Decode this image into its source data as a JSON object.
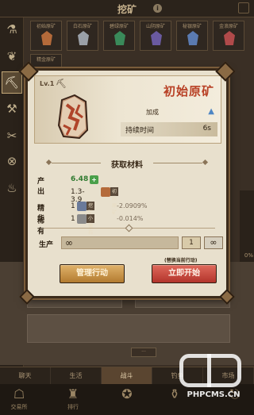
{
  "topbar": {
    "title": "挖矿"
  },
  "ore_slots": [
    {
      "label": "初始原矿",
      "color": "#b46a3a"
    },
    {
      "label": "白石原矿",
      "color": "#9aa0a8"
    },
    {
      "label": "碧绿原矿",
      "color": "#3a8a5a"
    },
    {
      "label": "山阴原矿",
      "color": "#6a5aa0"
    },
    {
      "label": "秘银原矿",
      "color": "#5a7ab0"
    },
    {
      "label": "金浪原矿",
      "color": "#b04a4a"
    }
  ],
  "ore_slot_extra": {
    "label": "精金原矿"
  },
  "modal": {
    "level": "Lv.1",
    "ore_name": "初始原矿",
    "bonus_label": "加成",
    "duration_label": "持续时间",
    "duration_value": "6s",
    "section_title": "获取材料",
    "output_label": "产出",
    "output_value": "6.48",
    "output_range": "1.3-3.9",
    "output_item": "初始原矿",
    "essence_label": "精华",
    "essence_count": "1",
    "essence_item": "挖矿之源",
    "essence_pct": "-2.0909%",
    "rare_label": "稀有",
    "rare_count": "1",
    "rare_item": "小块石合",
    "rare_pct": "-0.014%",
    "produce_label": "生产",
    "produce_value": "∞",
    "qty": "1",
    "qty_max": "∞",
    "replace_hint": "(替换当前行动)",
    "manage_button": "管理行动",
    "start_button": "立即开始"
  },
  "bottom_tabs": [
    "聊天",
    "生活",
    "战斗",
    "钓鱼",
    "市场"
  ],
  "bottom_nav": [
    "交易所",
    "排行",
    "",
    "",
    "退出"
  ],
  "watermark": {
    "text": "PHPCMS.CN"
  }
}
